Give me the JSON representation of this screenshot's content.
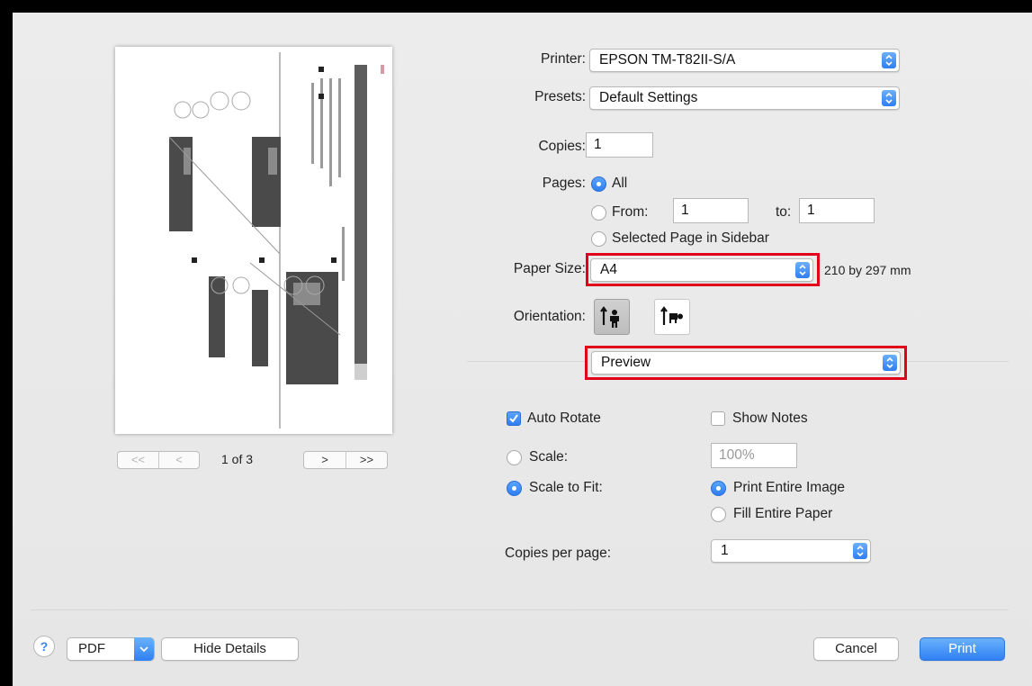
{
  "preview": {
    "first_label": "<<",
    "prev_label": "<",
    "page_indicator": "1 of 3",
    "next_label": ">",
    "last_label": ">>"
  },
  "printer": {
    "label": "Printer:",
    "value": "EPSON TM-T82II-S/A"
  },
  "presets": {
    "label": "Presets:",
    "value": "Default Settings"
  },
  "copies": {
    "label": "Copies:",
    "value": "1"
  },
  "pages": {
    "label": "Pages:",
    "all_label": "All",
    "from_label": "From:",
    "from_value": "1",
    "to_label": "to:",
    "to_value": "1",
    "sidebar_label": "Selected Page in Sidebar",
    "selected": "All"
  },
  "paper_size": {
    "label": "Paper Size:",
    "value": "A4",
    "dimensions": "210 by 297 mm"
  },
  "orientation": {
    "label": "Orientation:",
    "selected": "portrait"
  },
  "section": {
    "value": "Preview"
  },
  "auto_rotate": {
    "label": "Auto Rotate",
    "checked": true
  },
  "show_notes": {
    "label": "Show Notes",
    "checked": false
  },
  "scale": {
    "label": "Scale:",
    "value": "100%"
  },
  "scale_to_fit": {
    "label": "Scale to Fit:",
    "option1": "Print Entire Image",
    "option2": "Fill Entire Paper"
  },
  "copies_per_page": {
    "label": "Copies per page:",
    "value": "1"
  },
  "footer": {
    "help_label": "?",
    "pdf_label": "PDF",
    "hide_details_label": "Hide Details",
    "cancel_label": "Cancel",
    "print_label": "Print"
  },
  "colors": {
    "accent": "#2f80f4",
    "highlight_box": "#e0001a"
  }
}
